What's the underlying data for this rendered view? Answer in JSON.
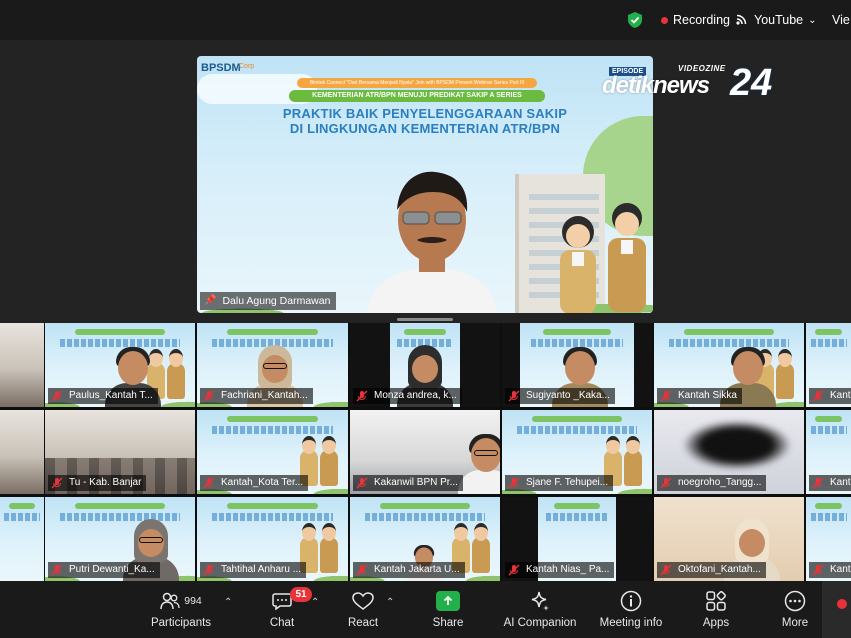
{
  "status_bar": {
    "recording_label": "Recording",
    "livestream_label": "YouTube",
    "view_label": "Vie"
  },
  "speaker": {
    "name": "Dalu Agung Darmawan",
    "slide": {
      "logo_left": "BPSDM",
      "logo_right": "Corp",
      "banner_small": "Bimtek Connect \"Dari Bersama Menjadi Nyata\" Join with BPSDM Present Webinar Series Part III",
      "ribbon": "KEMENTERIAN ATR/BPN MENUJU PREDIKAT SAKIP A SERIES",
      "title_line1": "PRAKTIK BAIK PENYELENGGARAAN SAKIP",
      "title_line2": "DI LINGKUNGAN KEMENTERIAN ATR/BPN",
      "episode": "EPISODE"
    }
  },
  "watermark": {
    "top": "VIDEOZINE",
    "brand": "detiknews",
    "number": "24"
  },
  "gallery": {
    "rows": [
      [
        "Paulus_Kantah T...",
        "Fachriani_Kantah...",
        "Monza andrea, k...",
        "Sugiyanto _Kaka...",
        "Kantah Sikka",
        "Kant"
      ],
      [
        "Tu - Kab. Banjar",
        "Kantah_Kota Ter...",
        "Kakanwil BPN Pr...",
        "Sjane F. Tehupei...",
        "noegroho_Tangg...",
        "Kant"
      ],
      [
        "Putri Dewanti_Ka...",
        "Tahtihal Anharu ...",
        "Kantah Jakarta U...",
        "Kantah Nias_ Pa...",
        "Oktofani_Kantah...",
        "Kant"
      ]
    ]
  },
  "toolbar": {
    "participants_label": "Participants",
    "participants_count": "994",
    "chat_label": "Chat",
    "chat_badge": "51",
    "react_label": "React",
    "share_label": "Share",
    "ai_label": "AI Companion",
    "meeting_info_label": "Meeting info",
    "apps_label": "Apps",
    "more_label": "More"
  },
  "colors": {
    "background": "#1a1a1a",
    "recording_red": "#e8333a",
    "share_green": "#22b04a",
    "shield_green": "#22b04a"
  }
}
